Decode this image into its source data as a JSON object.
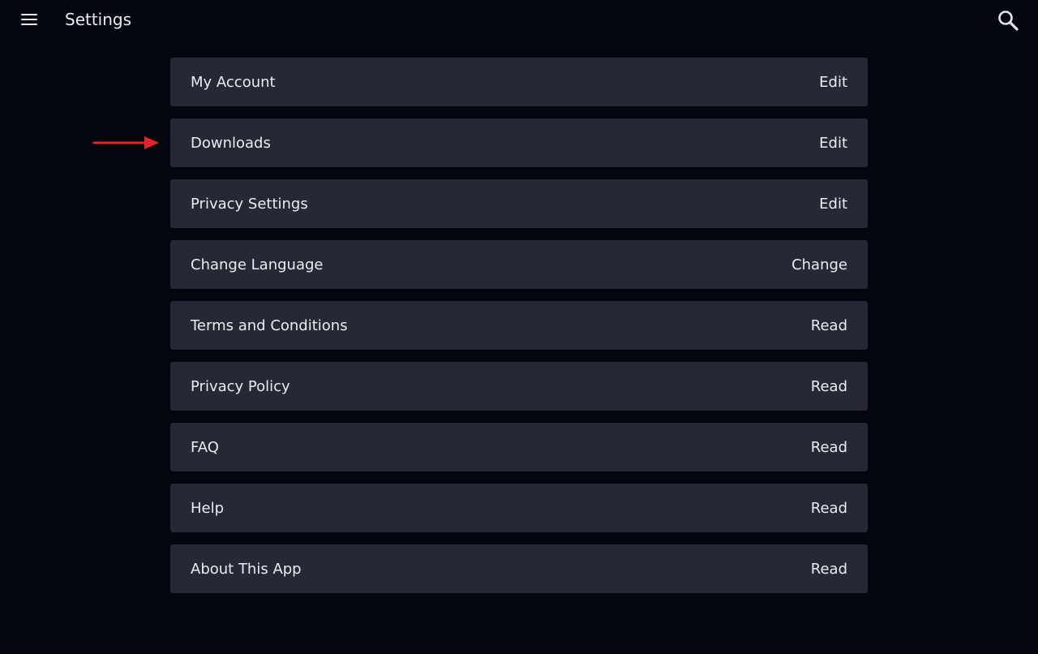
{
  "header": {
    "title": "Settings",
    "menu_icon": "hamburger-menu-icon",
    "search_icon": "search-icon"
  },
  "colors": {
    "background": "#03050f",
    "row_background": "#262935",
    "text": "#ececf0",
    "annotation_arrow": "#e0262b"
  },
  "settings": {
    "items": [
      {
        "label": "My Account",
        "action": "Edit"
      },
      {
        "label": "Downloads",
        "action": "Edit"
      },
      {
        "label": "Privacy Settings",
        "action": "Edit"
      },
      {
        "label": "Change Language",
        "action": "Change"
      },
      {
        "label": "Terms and Conditions",
        "action": "Read"
      },
      {
        "label": "Privacy Policy",
        "action": "Read"
      },
      {
        "label": "FAQ",
        "action": "Read"
      },
      {
        "label": "Help",
        "action": "Read"
      },
      {
        "label": "About This App",
        "action": "Read"
      }
    ]
  }
}
